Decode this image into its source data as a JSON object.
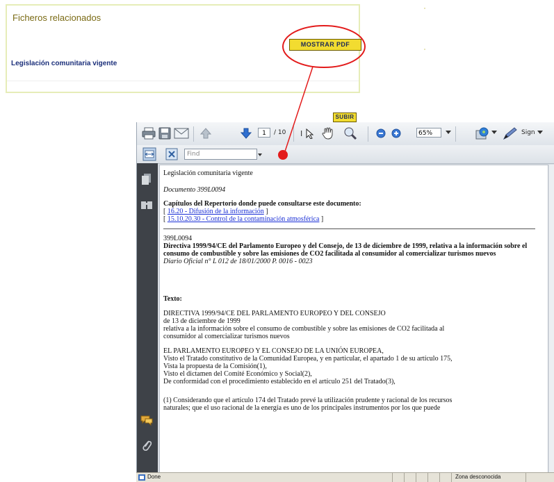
{
  "panel": {
    "title": "Ficheros relacionados",
    "link": "Legislación comunitaria vigente",
    "pdf_button": "MOSTRAR PDF"
  },
  "subir_button": "SUBIR",
  "annotation": {
    "color": "#e31b1b"
  },
  "viewer": {
    "toolbar": {
      "page_current": "1",
      "page_total": "/ 10",
      "zoom": "65%",
      "sign": "Sign",
      "find_placeholder": "Find",
      "icons": [
        "print-icon",
        "save-icon",
        "email-icon",
        "previous-page-icon",
        "next-page-icon",
        "select-tool-icon",
        "hand-tool-icon",
        "zoom-tool-icon",
        "zoom-out-icon",
        "zoom-in-icon",
        "share-icon",
        "sign-pen-icon",
        "fit-width-icon",
        "fit-page-icon"
      ]
    },
    "sidebar_icons": [
      "pages-icon",
      "bookmarks-icon",
      "comments-icon",
      "attachments-icon"
    ],
    "document": {
      "heading": "Legislación comunitaria vigente",
      "doc_number": "Documento 399L0094",
      "chapters_title": "Capítulos del Repertorio donde puede consultarse este documento:",
      "chapter_links": [
        {
          "pre": "[ ",
          "text": "16.20 - Difusión de la información",
          "post": " ]"
        },
        {
          "pre": "[ ",
          "text": "15.10.20.30 - Control de la contaminación atmosférica",
          "post": " ]"
        }
      ],
      "celex": "399L0094",
      "directive_title": "Directiva 1999/94/CE del Parlamento Europeo y del Consejo, de 13 de diciembre de 1999, relativa a la información sobre el consumo de combustible y sobre las emisiones de CO2 facilitada al consumidor al comercializar turismos nuevos",
      "journal": "Diario Oficial n° L 012 de 18/01/2000 P. 0016 - 0023",
      "texto_label": "Texto:",
      "body_lines_1": [
        "DIRECTIVA 1999/94/CE DEL PARLAMENTO EUROPEO Y DEL CONSEJO",
        "de 13 de diciembre de 1999",
        "relativa a la información sobre el consumo de combustible y sobre las emisiones de CO2 facilitada al",
        "consumidor al comercializar turismos nuevos"
      ],
      "body_lines_2": [
        "EL PARLAMENTO EUROPEO Y EL CONSEJO DE LA UNIÓN EUROPEA,",
        "Visto el Tratado constitutivo de la Comunidad Europea, y en particular, el apartado 1 de su artículo 175,",
        "Vista la propuesta de la Comisión(1),",
        "Visto el dictamen del Comité Económico y Social(2),",
        "De conformidad con el procedimiento establecido en el artículo 251 del Tratado(3),"
      ],
      "body_lines_3": [
        "(1) Considerando que el artículo 174 del Tratado prevé la utilización prudente y racional de los recursos",
        "naturales; que el uso racional de la energía es uno de los principales instrumentos por los que puede"
      ]
    },
    "status": {
      "left": "Done",
      "right": "Zona desconocida"
    }
  }
}
